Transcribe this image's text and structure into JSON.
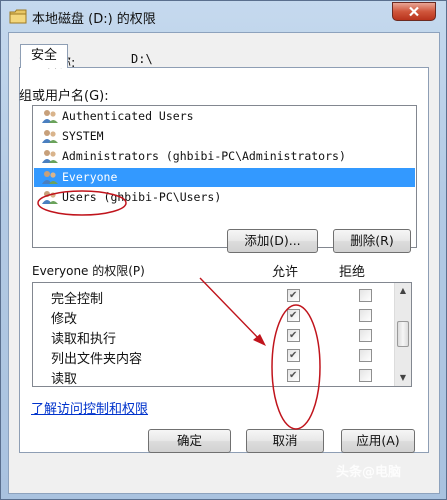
{
  "window": {
    "title": "本地磁盘 (D:) 的权限",
    "close_icon": "close-icon"
  },
  "tab": {
    "label": "安全"
  },
  "object": {
    "label": "对象名称:",
    "value": "D:\\"
  },
  "groups": {
    "label": "组或用户名(G):",
    "items": [
      {
        "name": "Authenticated Users",
        "icon": "users-icon",
        "selected": false
      },
      {
        "name": "SYSTEM",
        "icon": "users-icon",
        "selected": false
      },
      {
        "name": "Administrators (ghbibi-PC\\Administrators)",
        "icon": "users-icon",
        "selected": false
      },
      {
        "name": "Everyone",
        "icon": "users-icon",
        "selected": true
      },
      {
        "name": "Users (ghbibi-PC\\Users)",
        "icon": "users-icon",
        "selected": false
      }
    ]
  },
  "buttons": {
    "add": "添加(D)...",
    "remove": "删除(R)",
    "ok": "确定",
    "cancel": "取消",
    "apply": "应用(A)"
  },
  "permissions": {
    "header_label": "Everyone 的权限(P)",
    "allow_label": "允许",
    "deny_label": "拒绝",
    "items": [
      {
        "name": "完全控制",
        "allow": true,
        "deny": false
      },
      {
        "name": "修改",
        "allow": true,
        "deny": false
      },
      {
        "name": "读取和执行",
        "allow": true,
        "deny": false
      },
      {
        "name": "列出文件夹内容",
        "allow": true,
        "deny": false
      },
      {
        "name": "读取",
        "allow": true,
        "deny": false
      }
    ]
  },
  "link": {
    "text": "了解访问控制和权限"
  },
  "watermark": {
    "text": "头条@电脑"
  },
  "colors": {
    "selection": "#3399ff",
    "annotation": "#c0141c",
    "link": "#0033cc"
  }
}
